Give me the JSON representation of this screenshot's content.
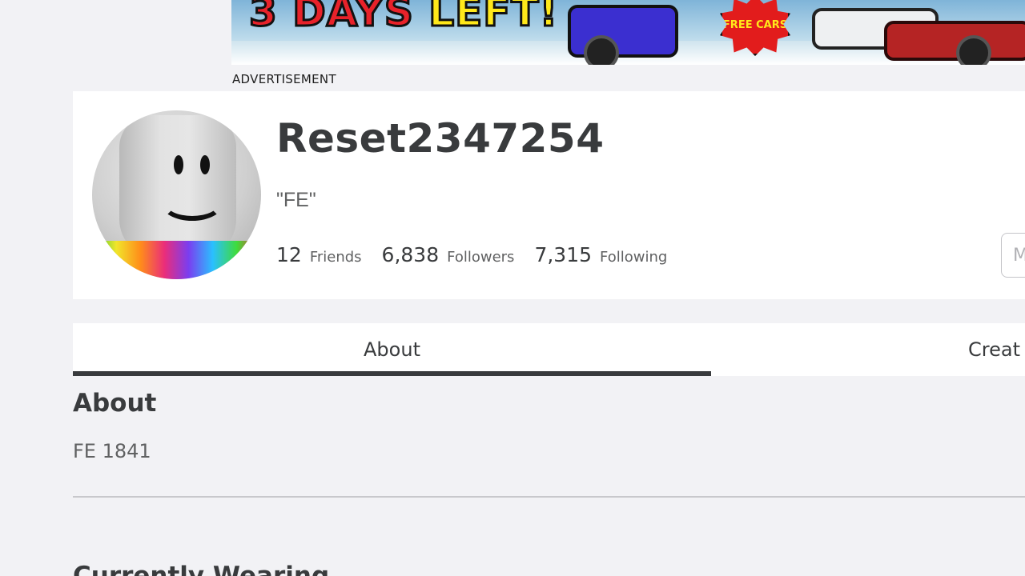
{
  "ad": {
    "headline_part1": "3 DAYS",
    "headline_part2": "LEFT!",
    "badge_text": "FREE CARS",
    "label": "ADVERTISEMENT"
  },
  "profile": {
    "username": "Reset2347254",
    "status": "\"FE\"",
    "stats": [
      {
        "count": "12",
        "label": "Friends"
      },
      {
        "count": "6,838",
        "label": "Followers"
      },
      {
        "count": "7,315",
        "label": "Following"
      }
    ],
    "more_button_label": "M"
  },
  "tabs": [
    {
      "label": "About",
      "active": true
    },
    {
      "label": "Creat",
      "active": false
    }
  ],
  "about": {
    "heading": "About",
    "body": "FE 1841"
  },
  "next_section": {
    "heading_visible": "Currently Wearing"
  }
}
